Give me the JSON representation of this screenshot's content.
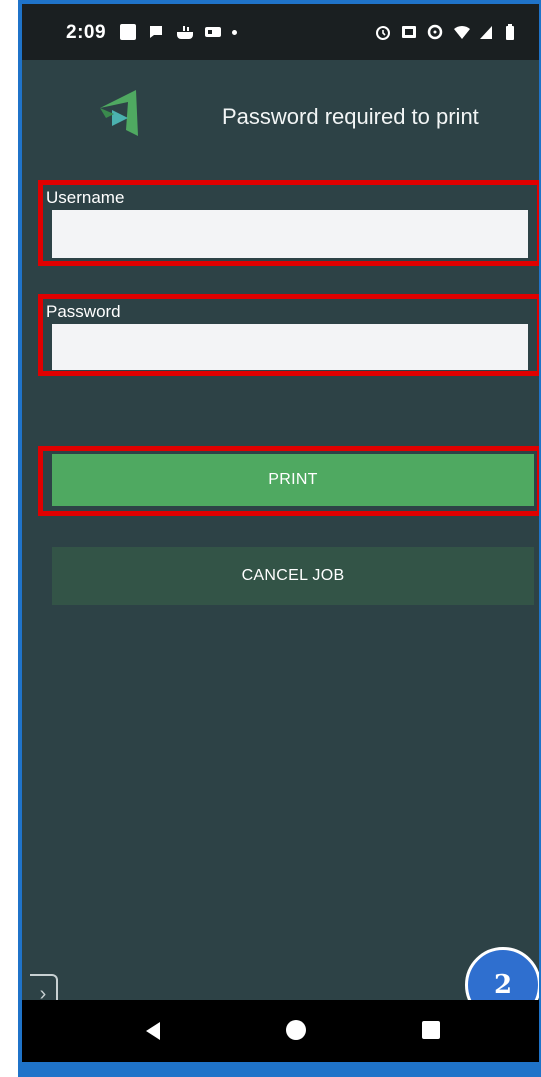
{
  "status_bar": {
    "time": "2:09",
    "left_icons": [
      "gallery-icon",
      "messenger-icon",
      "restaurant-icon",
      "news-icon",
      "dot-icon"
    ],
    "right_icons": [
      "alarm-icon",
      "cast-icon",
      "data-saver-icon",
      "wifi-icon",
      "signal-icon",
      "battery-icon"
    ]
  },
  "header": {
    "title": "Password required to print",
    "logo_icon": "print-app-logo-icon"
  },
  "form": {
    "username": {
      "label": "Username",
      "value": "",
      "placeholder": ""
    },
    "password": {
      "label": "Password",
      "value": "",
      "placeholder": ""
    }
  },
  "buttons": {
    "print_label": "PRINT",
    "cancel_label": "CANCEL JOB"
  },
  "overlay": {
    "step_badge": "2",
    "side_tab_icon": "chevron-right-icon"
  },
  "nav_bar": {
    "icons": [
      "back-icon",
      "home-icon",
      "recents-icon"
    ]
  },
  "colors": {
    "background": "#2d4246",
    "status_bar": "#1a1f21",
    "print_button": "#4fa961",
    "cancel_button": "#335447",
    "highlight": "#e00000",
    "frame": "#1f73c9",
    "badge": "#2f6fcf"
  }
}
